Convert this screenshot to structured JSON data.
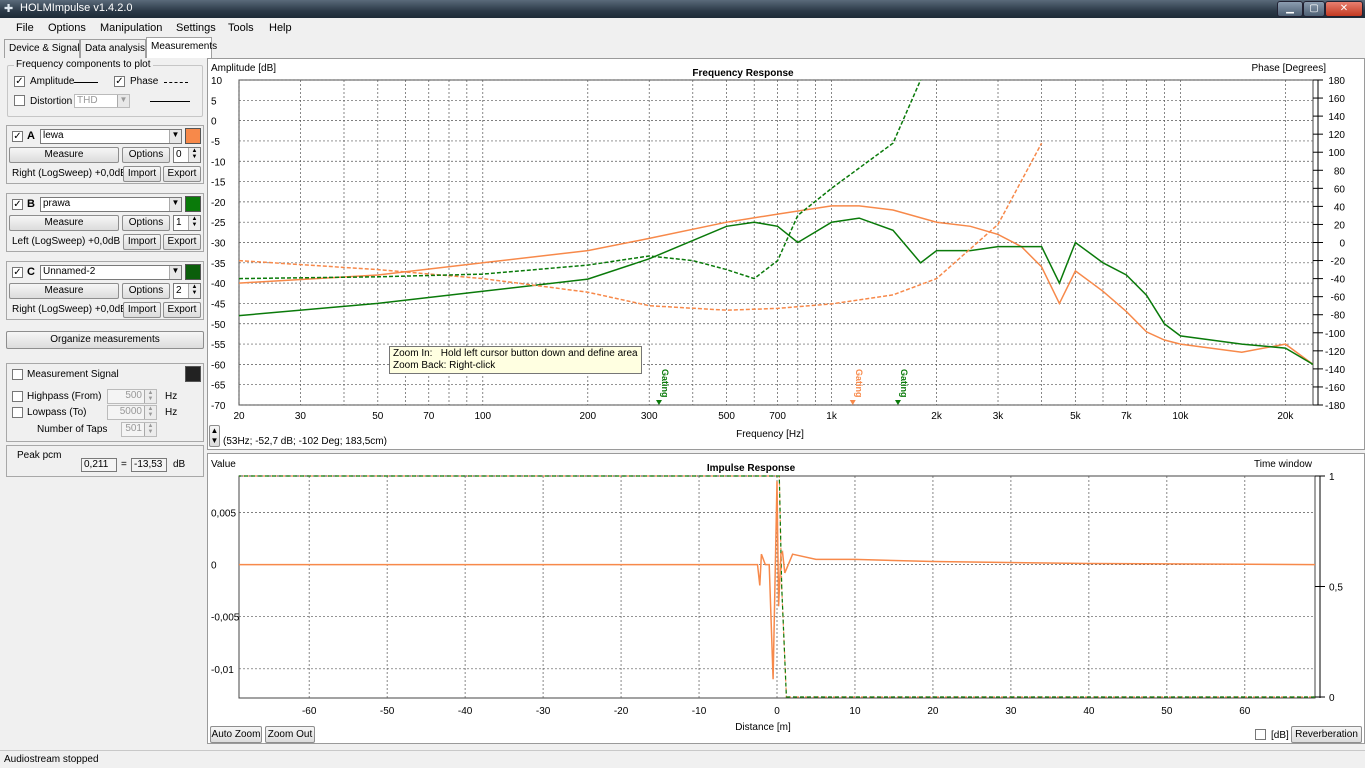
{
  "window": {
    "title": "HOLMImpulse  v1.4.2.0"
  },
  "menu": [
    "File",
    "Options",
    "Manipulation",
    "Settings",
    "Tools",
    "Help"
  ],
  "tabs": [
    "Device & Signal",
    "Data analysis",
    "Measurements"
  ],
  "active_tab": "Measurements",
  "freq_components": {
    "title": "Frequency components to plot",
    "amplitude_label": "Amplitude",
    "amplitude_checked": true,
    "phase_label": "Phase",
    "phase_checked": true,
    "distortion_label": "Distortion",
    "distortion_checked": false,
    "distortion_select": "THD"
  },
  "measurements": [
    {
      "letter": "A",
      "checked": true,
      "name": "lewa",
      "color": "#f7894a",
      "measure_label": "Measure",
      "options_label": "Options",
      "count": "0",
      "channel": "Right (LogSweep) +0,0dB",
      "import_label": "Import",
      "export_label": "Export"
    },
    {
      "letter": "B",
      "checked": true,
      "name": "prawa",
      "color": "#0a7a0a",
      "measure_label": "Measure",
      "options_label": "Options",
      "count": "1",
      "channel": "Left (LogSweep) +0,0dB",
      "import_label": "Import",
      "export_label": "Export"
    },
    {
      "letter": "C",
      "checked": true,
      "name": "Unnamed-2",
      "color": "#0b5e0b",
      "measure_label": "Measure",
      "options_label": "Options",
      "count": "2",
      "channel": "Right (LogSweep) +0,0dB",
      "import_label": "Import",
      "export_label": "Export"
    }
  ],
  "organize_label": "Organize measurements",
  "measurement_signal": {
    "label": "Measurement Signal",
    "checked": false,
    "color": "#222222",
    "highpass_label": "Highpass (From)",
    "highpass_value": "500",
    "highpass_unit": "Hz",
    "lowpass_label": "Lowpass (To)",
    "lowpass_value": "5000",
    "lowpass_unit": "Hz",
    "taps_label": "Number of Taps",
    "taps_value": "501"
  },
  "peak": {
    "label": "Peak pcm",
    "value": "0,211",
    "eq": "=",
    "db_value": "-13,53",
    "db_unit": "dB"
  },
  "freq_plot": {
    "title": "Frequency Response",
    "ylabel": "Amplitude [dB]",
    "y2label": "Phase [Degrees]",
    "xlabel": "Frequency [Hz]",
    "cursor_readout": "(53Hz; -52,7 dB; -102 Deg; 183,5cm)",
    "gating_label": "Gating",
    "tooltip_line1": "Zoom In:   Hold left cursor button down and define area",
    "tooltip_line2": "Zoom Back: Right-click"
  },
  "impulse_plot": {
    "title": "Impulse Response",
    "ylabel": "Value",
    "y2label": "Time window",
    "xlabel": "Distance [m]",
    "auto_zoom_label": "Auto Zoom",
    "zoom_out_label": "Zoom Out",
    "db_label": "[dB]",
    "db_checked": false,
    "reverberation_label": "Reverberation"
  },
  "status": "Audiostream stopped",
  "chart_data": [
    {
      "type": "line",
      "title": "Frequency Response",
      "xlabel": "Frequency [Hz]",
      "ylabel": "Amplitude [dB]",
      "y2label": "Phase [Degrees]",
      "x_scale": "log",
      "xlim": [
        20,
        24000
      ],
      "ylim": [
        -70,
        10
      ],
      "y2lim": [
        -180,
        180
      ],
      "x_ticks": [
        "20",
        "30",
        "50",
        "70",
        "100",
        "200",
        "300",
        "500",
        "700",
        "1k",
        "2k",
        "3k",
        "5k",
        "7k",
        "10k",
        "20k"
      ],
      "y_ticks": [
        10,
        5,
        0,
        -5,
        -10,
        -15,
        -20,
        -25,
        -30,
        -35,
        -40,
        -45,
        -50,
        -55,
        -60,
        -65,
        -70
      ],
      "y2_ticks": [
        180,
        160,
        140,
        120,
        100,
        80,
        60,
        40,
        20,
        0,
        -20,
        -40,
        -60,
        -80,
        -100,
        -120,
        -140,
        -160,
        -180
      ],
      "grid": true,
      "gating_markers_hz": [
        320,
        1150,
        1550
      ],
      "series": [
        {
          "kind": "amplitude",
          "color": "#f7894a",
          "style": "solid",
          "x": [
            20,
            50,
            100,
            200,
            300,
            500,
            700,
            1000,
            1200,
            1500,
            2000,
            2500,
            3000,
            3500,
            4000,
            4500,
            5000,
            6000,
            7000,
            8000,
            9000,
            10000,
            15000,
            20000,
            24000
          ],
          "y": [
            -40,
            -38,
            -35,
            -32,
            -29,
            -25,
            -23,
            -21,
            -21,
            -22,
            -25,
            -26,
            -28,
            -31,
            -36,
            -45,
            -37,
            -42,
            -47,
            -52,
            -54,
            -55,
            -57,
            -55,
            -60
          ]
        },
        {
          "kind": "amplitude",
          "color": "#0a7a0a",
          "style": "solid",
          "x": [
            20,
            50,
            100,
            200,
            300,
            500,
            600,
            700,
            800,
            1000,
            1200,
            1500,
            1800,
            2000,
            2500,
            3000,
            4000,
            4500,
            5000,
            6000,
            7000,
            8000,
            9000,
            10000,
            15000,
            20000,
            24000
          ],
          "y": [
            -48,
            -45,
            -42,
            -39,
            -34,
            -26,
            -25,
            -26,
            -30,
            -25,
            -24,
            -27,
            -35,
            -32,
            -32,
            -31,
            -31,
            -40,
            -30,
            -35,
            -38,
            -43,
            -50,
            -53,
            -55,
            -56,
            -60
          ]
        },
        {
          "kind": "phase",
          "color": "#f7894a",
          "style": "dashed",
          "x": [
            20,
            50,
            100,
            200,
            300,
            500,
            700,
            1000,
            1500,
            2000,
            3000,
            4000
          ],
          "y": [
            -20,
            -30,
            -40,
            -55,
            -70,
            -75,
            -73,
            -68,
            -58,
            -40,
            20,
            110
          ]
        },
        {
          "kind": "phase",
          "color": "#0a7a0a",
          "style": "dashed",
          "x": [
            20,
            50,
            100,
            200,
            300,
            400,
            500,
            600,
            700,
            800,
            1000,
            1500,
            1800
          ],
          "y": [
            -40,
            -38,
            -35,
            -25,
            -15,
            -20,
            -30,
            -40,
            -20,
            30,
            60,
            110,
            180
          ]
        }
      ]
    },
    {
      "type": "line",
      "title": "Impulse Response",
      "xlabel": "Distance [m]",
      "ylabel": "Value",
      "y2label": "Time window",
      "xlim": [
        -69,
        69
      ],
      "ylim": [
        -0.0128,
        0.0085
      ],
      "y2lim": [
        0,
        1
      ],
      "x_ticks": [
        -60,
        -50,
        -40,
        -30,
        -20,
        -10,
        0,
        10,
        20,
        30,
        40,
        50,
        60
      ],
      "y_ticks": [
        "0,005",
        "0",
        "-0,005",
        "-0,01"
      ],
      "y2_ticks": [
        "1",
        "0,5",
        "0"
      ],
      "grid": true,
      "series": [
        {
          "name": "lewa",
          "color": "#f7894a",
          "x": [
            -69,
            -2.5,
            -2.2,
            -2,
            -1.5,
            -1,
            -0.5,
            0,
            0.2,
            0.5,
            0.7,
            1,
            2,
            5,
            10,
            20,
            40,
            69
          ],
          "y": [
            0,
            0,
            -0.002,
            0.001,
            0,
            0,
            -0.011,
            0.008,
            -0.004,
            0.001,
            0.0012,
            -0.0008,
            0.001,
            0.0005,
            0.0005,
            0.0003,
            0.0001,
            0
          ]
        },
        {
          "name": "time window",
          "color": "#0a7a0a",
          "style": "dashed",
          "x": [
            -69,
            0,
            0.3,
            0.6,
            1.2,
            69
          ],
          "y": [
            1,
            1,
            1,
            0.5,
            0,
            0
          ]
        }
      ]
    }
  ]
}
